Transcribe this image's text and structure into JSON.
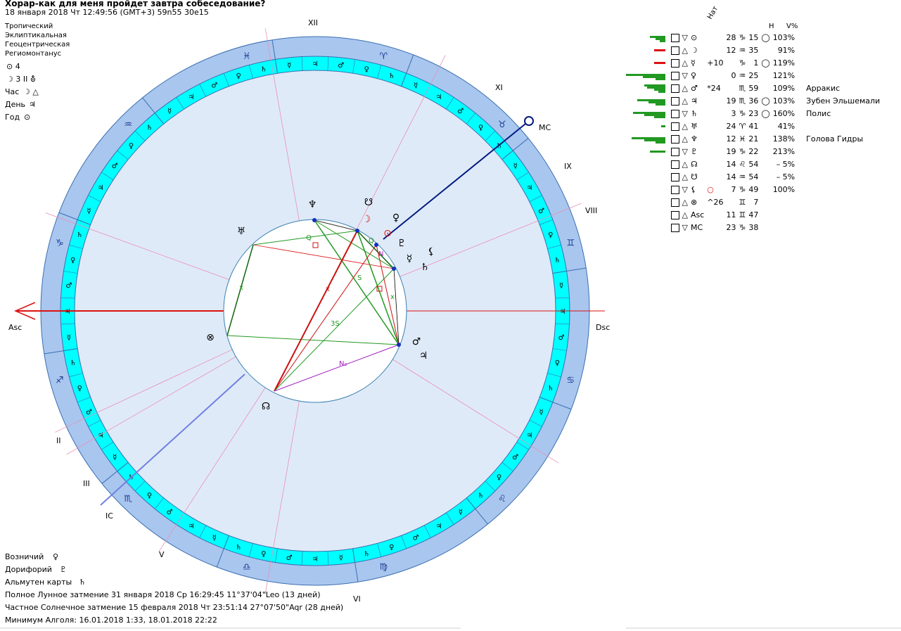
{
  "header": {
    "title": "Хорар-как для меня пройдет завтра собеседование?",
    "subtitle": "18 января 2018  Чт  12:49:56 (GMT+3) 59n55  30e15"
  },
  "settings": [
    "Тропический",
    "Эклиптикальная",
    "Геоцентрическая",
    "Региомонтанус"
  ],
  "info": {
    "sun_line": "⊙  4",
    "moon_line": "☽  3 II ⛢",
    "hour_label": "Час",
    "hour_value": "☽ △",
    "day_label": "День",
    "day_value": "♃",
    "year_label": "Год",
    "year_value": "⊙"
  },
  "chart": {
    "asc_label": "Asc",
    "dsc_label": "Dsc",
    "mc_label": "MC",
    "ic_label": "IC",
    "houses": [
      "XII",
      "XI",
      "IX",
      "VIII",
      "II",
      "III",
      "V",
      "VI"
    ],
    "signs": [
      "♓",
      "♒",
      "♑",
      "♐",
      "♏",
      "♎",
      "♍",
      "♌",
      "♋",
      "♊",
      "♉",
      "♈"
    ],
    "aspect_labels": [
      "Q",
      "Q",
      "S",
      "3S",
      "N₂",
      "N",
      "x",
      "x",
      "x"
    ],
    "planet_glyphs": [
      "♅",
      "♆",
      "☋",
      "☽",
      "♀",
      "⊙",
      "♇",
      "☿",
      "⚸",
      "♄",
      "♂",
      "♃",
      "⊗",
      "☊"
    ]
  },
  "table": {
    "col_nat": "Нат",
    "col_h": "H",
    "col_v": "V%",
    "rows": [
      {
        "glyph": "⊙",
        "extra": "",
        "deg": "28",
        "sign": "♑",
        "min": "15",
        "h": "◯",
        "v": "103%",
        "star": "",
        "bar_color": "#229922",
        "bars": [
          22,
          14,
          8
        ]
      },
      {
        "glyph": "☽",
        "extra": "",
        "deg": "12",
        "sign": "♒",
        "min": "35",
        "h": "",
        "v": "91%",
        "star": "",
        "bar_color": "#dd1111",
        "bars": [
          16
        ]
      },
      {
        "glyph": "☿",
        "extra": "+10",
        "deg": "",
        "sign": "♑",
        "min": "1",
        "h": "◯",
        "v": "119%",
        "star": "",
        "bar_color": "#dd1111",
        "bars": [
          16
        ]
      },
      {
        "glyph": "♀",
        "extra": "",
        "deg": "0",
        "sign": "♒",
        "min": "25",
        "h": "",
        "v": "121%",
        "star": "",
        "bar_color": "#229922",
        "bars": [
          56,
          32,
          14
        ]
      },
      {
        "glyph": "♂",
        "extra": "*24",
        "deg": "",
        "sign": "♏",
        "min": "59",
        "h": "",
        "v": "109%",
        "star": "Арракис",
        "bar_color": "#229922",
        "bars": [
          30,
          26,
          16,
          10
        ]
      },
      {
        "glyph": "♃",
        "extra": "",
        "deg": "19",
        "sign": "♏",
        "min": "36",
        "h": "◯",
        "v": "103%",
        "star": "Зубен Эльшемали",
        "bar_color": "#229922",
        "bars": [
          40,
          24,
          14
        ]
      },
      {
        "glyph": "♄",
        "extra": "",
        "deg": "3",
        "sign": "♑",
        "min": "23",
        "h": "◯",
        "v": "160%",
        "star": "Полис",
        "bar_color": "#229922",
        "bars": [
          46,
          30,
          16
        ]
      },
      {
        "glyph": "♅",
        "extra": "",
        "deg": "24",
        "sign": "♈",
        "min": "41",
        "h": "",
        "v": "41%",
        "star": "",
        "bar_color": "#229922",
        "bars": [
          6
        ]
      },
      {
        "glyph": "♆",
        "extra": "",
        "deg": "12",
        "sign": "♓",
        "min": "21",
        "h": "",
        "v": "138%",
        "star": "Голова Гидры",
        "bar_color": "#229922",
        "bars": [
          48,
          30,
          14
        ]
      },
      {
        "glyph": "♇",
        "extra": "",
        "deg": "19",
        "sign": "♑",
        "min": "22",
        "h": "",
        "v": "213%",
        "star": "",
        "bar_color": "#229922",
        "bars": [
          22
        ]
      },
      {
        "glyph": "☊",
        "extra": "",
        "deg": "14",
        "sign": "♌",
        "min": "54",
        "h": "",
        "v": "–  5%",
        "star": "",
        "bar_color": "",
        "bars": []
      },
      {
        "glyph": "☋",
        "extra": "",
        "deg": "14",
        "sign": "♒",
        "min": "54",
        "h": "",
        "v": "–  5%",
        "star": "",
        "bar_color": "",
        "bars": []
      },
      {
        "glyph": "⚸",
        "extra": "○",
        "deg": "7",
        "sign": "♑",
        "min": "49",
        "h": "",
        "v": "100%",
        "star": "",
        "bar_color": "",
        "bars": []
      },
      {
        "glyph": "⊗",
        "extra": "^26",
        "deg": "",
        "sign": "♊",
        "min": "7",
        "h": "",
        "v": "",
        "star": "",
        "bar_color": "",
        "bars": []
      },
      {
        "glyph": "Asc",
        "extra": "",
        "deg": "11",
        "sign": "♊",
        "min": "47",
        "h": "",
        "v": "",
        "star": "",
        "bar_color": "",
        "bars": []
      },
      {
        "glyph": "MC",
        "extra": "",
        "deg": "23",
        "sign": "♑",
        "min": "38",
        "h": "",
        "v": "",
        "star": "",
        "bar_color": "",
        "bars": []
      }
    ]
  },
  "footer": {
    "vozn_label": "Возничий",
    "vozn_value": "♀",
    "dor_label": "Дорифорий",
    "dor_value": "♇",
    "alm_label": "Альмутен карты",
    "alm_value": "♄",
    "eclipse1": "Полное Лунное затмение 31 января 2018 Ср 16:29:45 11°37'04\"Leo (13 дней)",
    "eclipse2": "Частное Солнечное затмение 15 февраля 2018 Чт 23:51:14 27°07'50\"Aqr (28 дней)",
    "algol": "Минимум Алголя: 16.01.2018  1:33,  18.01.2018 22:22"
  },
  "colors": {
    "outer_ring": "#a9c6ef",
    "inner_ring": "#00ffff",
    "disc": "#dfeaf8",
    "asc_line": "#dd1111",
    "mc_line": "#001a80",
    "green": "#229922"
  }
}
